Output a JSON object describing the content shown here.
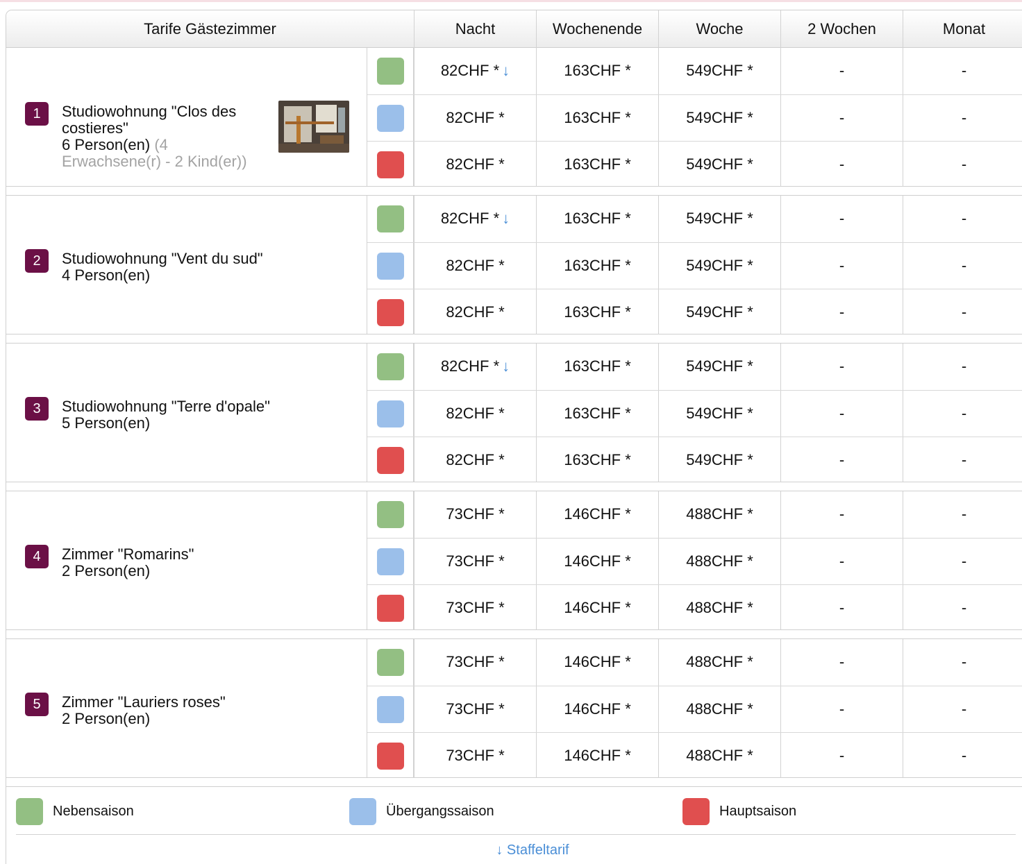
{
  "header": {
    "title": "Tarife Gästezimmer",
    "columns": [
      "Nacht",
      "Wochenende",
      "Woche",
      "2 Wochen",
      "Monat"
    ]
  },
  "colors": {
    "low": "#93bf83",
    "mid": "#9bbfea",
    "high": "#e04f4f",
    "badge": "#6b1046",
    "link": "#4a8ed6"
  },
  "rooms": [
    {
      "number": "1",
      "name": "Studiowohnung \"Clos des costieres\"",
      "capacity": "6 Person(en)",
      "detail": "(4 Erwachsene(r) - 2 Kind(er))",
      "rows": [
        {
          "season": "low",
          "night": "82CHF *",
          "arrow": "↓",
          "weekend": "163CHF *",
          "week": "549CHF *",
          "two_weeks": "-",
          "month": "-"
        },
        {
          "season": "mid",
          "night": "82CHF *",
          "arrow": "",
          "weekend": "163CHF *",
          "week": "549CHF *",
          "two_weeks": "-",
          "month": "-"
        },
        {
          "season": "high",
          "night": "82CHF *",
          "arrow": "",
          "weekend": "163CHF *",
          "week": "549CHF *",
          "two_weeks": "-",
          "month": "-"
        }
      ]
    },
    {
      "number": "2",
      "name": "Studiowohnung \"Vent du sud\"",
      "capacity": "4 Person(en)",
      "detail": "",
      "rows": [
        {
          "season": "low",
          "night": "82CHF *",
          "arrow": "↓",
          "weekend": "163CHF *",
          "week": "549CHF *",
          "two_weeks": "-",
          "month": "-"
        },
        {
          "season": "mid",
          "night": "82CHF *",
          "arrow": "",
          "weekend": "163CHF *",
          "week": "549CHF *",
          "two_weeks": "-",
          "month": "-"
        },
        {
          "season": "high",
          "night": "82CHF *",
          "arrow": "",
          "weekend": "163CHF *",
          "week": "549CHF *",
          "two_weeks": "-",
          "month": "-"
        }
      ]
    },
    {
      "number": "3",
      "name": "Studiowohnung \"Terre d'opale\"",
      "capacity": "5 Person(en)",
      "detail": "",
      "rows": [
        {
          "season": "low",
          "night": "82CHF *",
          "arrow": "↓",
          "weekend": "163CHF *",
          "week": "549CHF *",
          "two_weeks": "-",
          "month": "-"
        },
        {
          "season": "mid",
          "night": "82CHF *",
          "arrow": "",
          "weekend": "163CHF *",
          "week": "549CHF *",
          "two_weeks": "-",
          "month": "-"
        },
        {
          "season": "high",
          "night": "82CHF *",
          "arrow": "",
          "weekend": "163CHF *",
          "week": "549CHF *",
          "two_weeks": "-",
          "month": "-"
        }
      ]
    },
    {
      "number": "4",
      "name": "Zimmer \"Romarins\"",
      "capacity": "2 Person(en)",
      "detail": "",
      "rows": [
        {
          "season": "low",
          "night": "73CHF *",
          "arrow": "",
          "weekend": "146CHF *",
          "week": "488CHF *",
          "two_weeks": "-",
          "month": "-"
        },
        {
          "season": "mid",
          "night": "73CHF *",
          "arrow": "",
          "weekend": "146CHF *",
          "week": "488CHF *",
          "two_weeks": "-",
          "month": "-"
        },
        {
          "season": "high",
          "night": "73CHF *",
          "arrow": "",
          "weekend": "146CHF *",
          "week": "488CHF *",
          "two_weeks": "-",
          "month": "-"
        }
      ]
    },
    {
      "number": "5",
      "name": "Zimmer \"Lauriers roses\"",
      "capacity": "2 Person(en)",
      "detail": "",
      "rows": [
        {
          "season": "low",
          "night": "73CHF *",
          "arrow": "",
          "weekend": "146CHF *",
          "week": "488CHF *",
          "two_weeks": "-",
          "month": "-"
        },
        {
          "season": "mid",
          "night": "73CHF *",
          "arrow": "",
          "weekend": "146CHF *",
          "week": "488CHF *",
          "two_weeks": "-",
          "month": "-"
        },
        {
          "season": "high",
          "night": "73CHF *",
          "arrow": "",
          "weekend": "146CHF *",
          "week": "488CHF *",
          "two_weeks": "-",
          "month": "-"
        }
      ]
    }
  ],
  "legend": [
    {
      "season": "low",
      "label": "Nebensaison"
    },
    {
      "season": "mid",
      "label": "Übergangssaison"
    },
    {
      "season": "high",
      "label": "Hauptsaison"
    }
  ],
  "staffel_link": "↓ Staffeltarif"
}
